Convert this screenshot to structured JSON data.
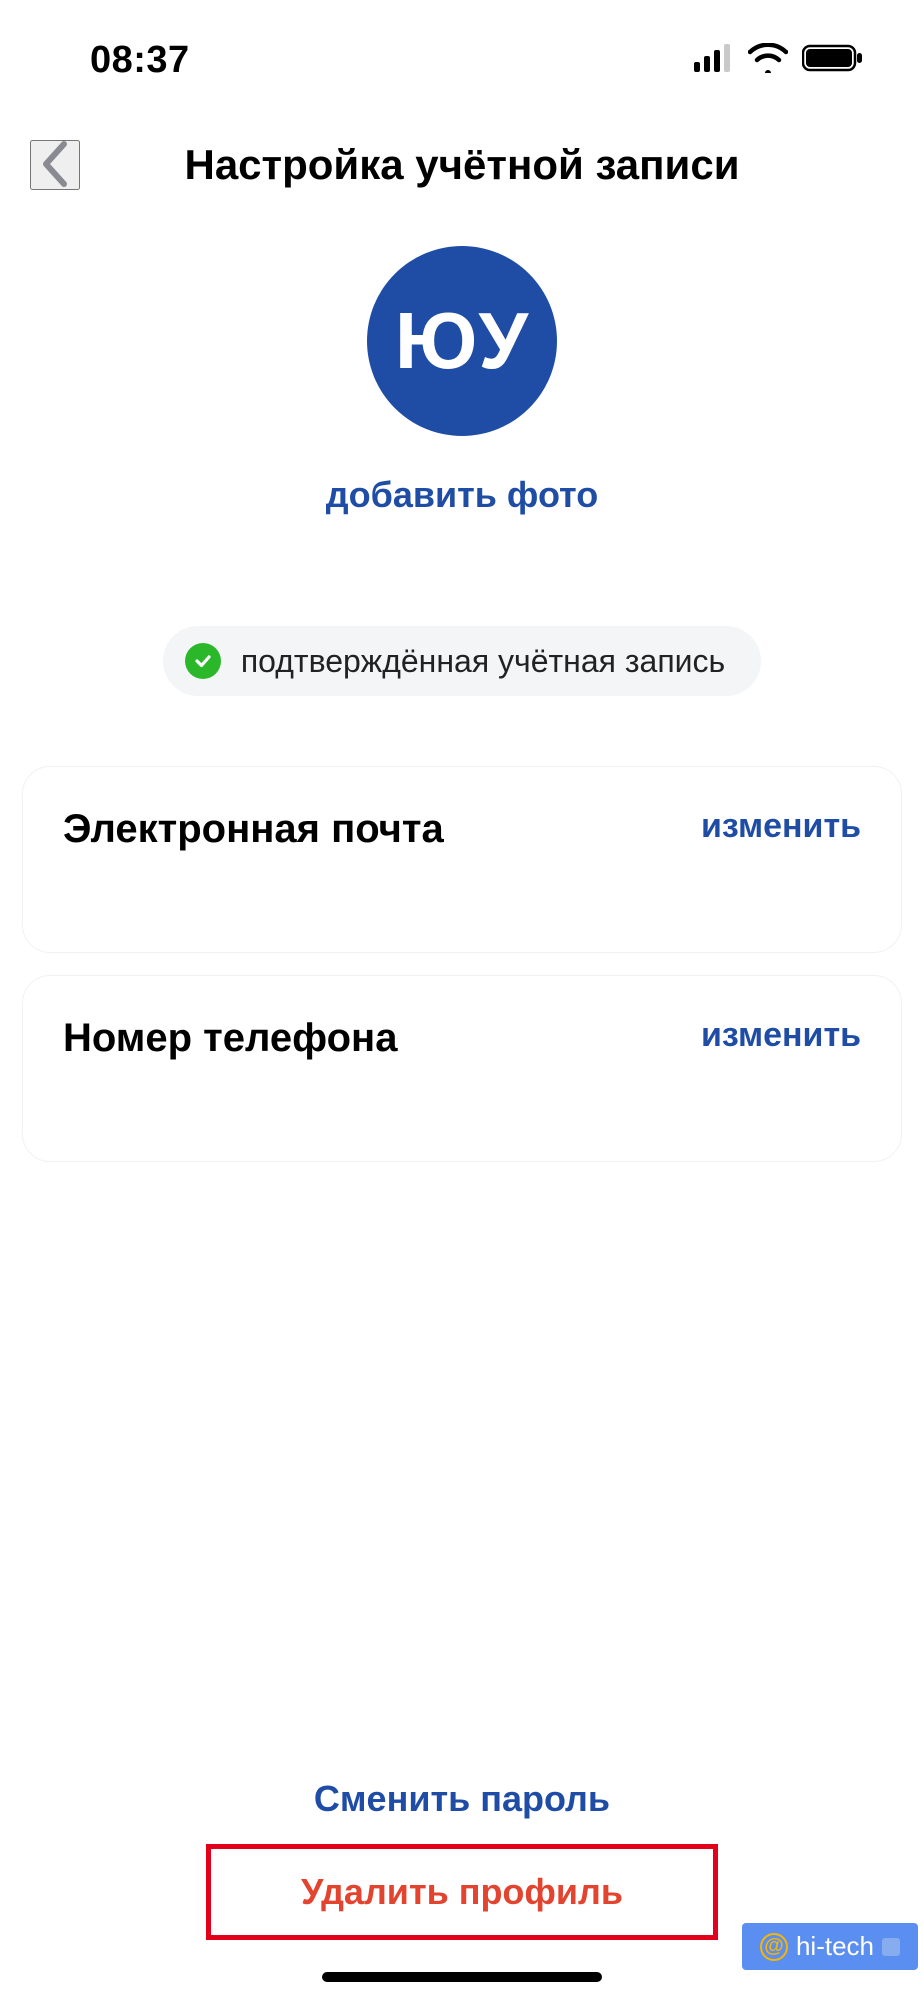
{
  "statusbar": {
    "time": "08:37"
  },
  "nav": {
    "title": "Настройка учётной записи"
  },
  "avatar": {
    "initials": "ЮУ",
    "add_photo_label": "добавить фото"
  },
  "verified": {
    "label": "подтверждённая учётная запись"
  },
  "cards": {
    "email": {
      "title": "Электронная почта",
      "action": "изменить"
    },
    "phone": {
      "title": "Номер телефона",
      "action": "изменить"
    }
  },
  "bottom": {
    "change_password": "Сменить пароль",
    "delete_profile": "Удалить профиль"
  },
  "watermark": {
    "text": "hi-tech"
  },
  "colors": {
    "brand": "#1f4da6",
    "danger": "#e2442f",
    "highlight_border": "#e2001a",
    "verified_green": "#2ab82a"
  }
}
